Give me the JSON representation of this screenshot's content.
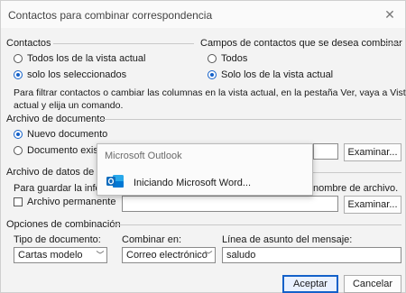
{
  "window": {
    "title": "Contactos para combinar correspondencia"
  },
  "contacts": {
    "heading": "Contactos",
    "options": [
      "Todos los de la vista actual",
      "solo los seleccionados"
    ],
    "selected_index": 1
  },
  "fields": {
    "heading": "Campos de contactos que se desea combinar",
    "options": [
      "Todos",
      "Solo los de la vista actual"
    ],
    "selected_index": 1
  },
  "filter_hint": {
    "line1": "Para filtrar contactos o cambiar las columnas en la vista actual, en la pestaña Ver, vaya a Vista",
    "line2": "actual y elija un comando."
  },
  "document_file": {
    "heading": "Archivo de documento",
    "option_new": "Nuevo documento",
    "option_existing": "Documento existe",
    "selected": "new",
    "browse": "Examinar..."
  },
  "data_file": {
    "heading": "Archivo de datos de lo",
    "text_left": "Para guardar la inform",
    "text_right": "nombre de archivo.",
    "checkbox_label": "Archivo permanente",
    "browse": "Examinar..."
  },
  "merge_options": {
    "heading": "Opciones de combinación",
    "doc_type_label": "Tipo de documento:",
    "doc_type_value": "Cartas modelo",
    "merge_to_label": "Combinar en:",
    "merge_to_value": "Correo electrónico",
    "subject_label": "Línea de asunto del mensaje:",
    "subject_value": "saludo"
  },
  "buttons": {
    "ok": "Aceptar",
    "cancel": "Cancelar"
  },
  "popup": {
    "title": "Microsoft Outlook",
    "message": "Iniciando Microsoft Word...",
    "icon": "outlook-icon",
    "icon_color": "#0f6cbd"
  }
}
